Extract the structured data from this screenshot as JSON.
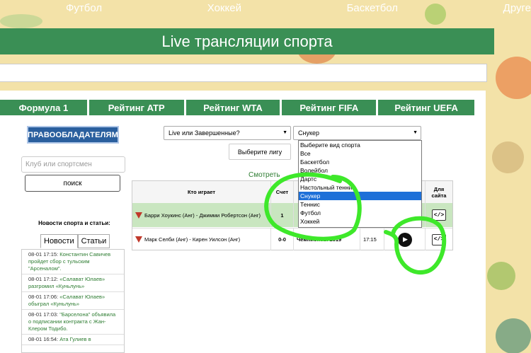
{
  "top_nav": [
    "Футбол",
    "Хоккей",
    "Баскетбол",
    "Друге"
  ],
  "page_title": "Live трансляции спорта",
  "category_tabs": [
    "Формула 1",
    "Рейтинг ATP",
    "Рейтинг WTA",
    "Рейтинг FIFA",
    "Рейтинг UEFA"
  ],
  "sidebar": {
    "banner": "ПРАВООБЛАДАТЕЛЯМ",
    "search_placeholder": "Клуб или спортсмен",
    "search_button": "поиск",
    "news_heading": "Новости спорта и статьи:",
    "news_tabs": [
      "Новости",
      "Статьи"
    ],
    "news": [
      {
        "time": "08-01 17:15:",
        "text": "Константин Савичев пройдет сбор с тульским \"Арсеналом\"."
      },
      {
        "time": "08-01 17:12:",
        "text": "«Салават Юлаев» разгромил «Куньлунь»"
      },
      {
        "time": "08-01 17:06:",
        "text": "«Салават Юлаев» обыграл «Куньлунь»"
      },
      {
        "time": "08-01 17:03:",
        "text": "\"Барселона\" объявила о подписании контракта с Жан-Клером Тодибо."
      },
      {
        "time": "08-01 16:54:",
        "text": "Ата Гулиев в"
      }
    ]
  },
  "filters": {
    "status_select": "Live или Завершенные?",
    "sport_select": "Снукер",
    "league_button": "Выберите лигу",
    "watch_link": "Смотреть"
  },
  "sport_dropdown": {
    "options": [
      "Выберите вид спорта",
      "Все",
      "Баскетбол",
      "Волейбол",
      "Дартс",
      "Настольный теннис",
      "Снукер",
      "Теннис",
      "Футбол",
      "Хоккей"
    ],
    "selected": "Снукер"
  },
  "table": {
    "headers": [
      "Кто играет",
      "Счет",
      "",
      "",
      "",
      "Для сайта"
    ],
    "rows": [
      {
        "match": "Барри Хоукинс (Анг) - Джимми Робертсон (Анг)",
        "score": "1",
        "league": "",
        "time": "",
        "live": true
      },
      {
        "match": "Марк Селби (Анг) - Кирен Уилсон (Анг)",
        "score": "0-0",
        "league": "Чемпионов. 2019",
        "time": "17:15",
        "live": false
      }
    ],
    "embed_label": "</>"
  },
  "colors": {
    "accent_green": "#3a8f55",
    "annotation": "#3ee82a",
    "selection": "#1e70d8"
  }
}
